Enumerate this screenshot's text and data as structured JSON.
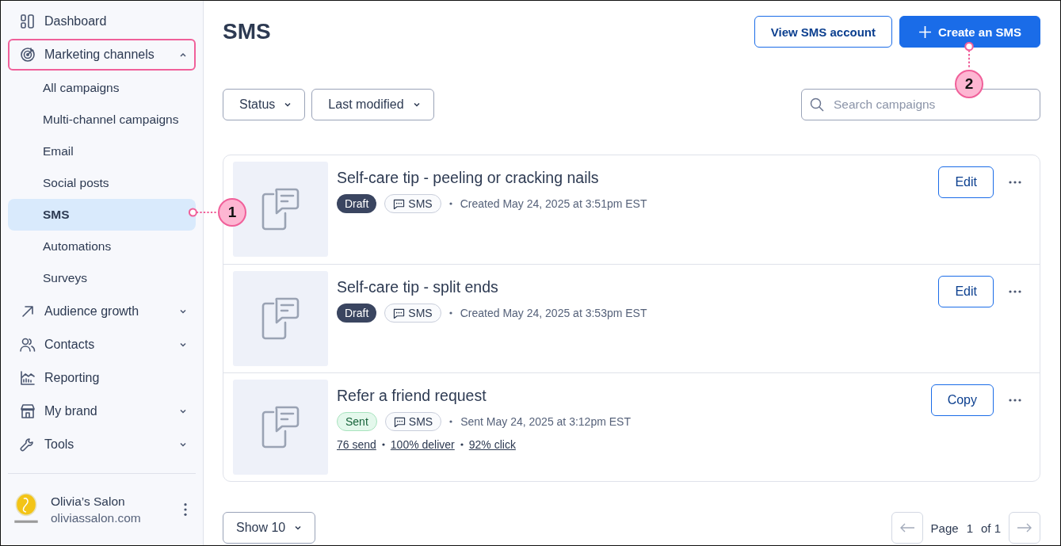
{
  "sidebar": {
    "items": [
      {
        "kind": "link",
        "label": "Dashboard"
      },
      {
        "kind": "group",
        "label": "Marketing channels",
        "expanded": true,
        "highlighted": true,
        "children": [
          {
            "label": "All campaigns",
            "selected": false
          },
          {
            "label": "Multi-channel campaigns",
            "selected": false
          },
          {
            "label": "Email",
            "selected": false
          },
          {
            "label": "Social posts",
            "selected": false
          },
          {
            "label": "SMS",
            "selected": true
          },
          {
            "label": "Automations",
            "selected": false
          },
          {
            "label": "Surveys",
            "selected": false
          }
        ]
      },
      {
        "kind": "group",
        "label": "Audience growth",
        "expanded": false,
        "highlighted": false
      },
      {
        "kind": "group",
        "label": "Contacts",
        "expanded": false,
        "highlighted": false
      },
      {
        "kind": "link",
        "label": "Reporting"
      },
      {
        "kind": "group",
        "label": "My brand",
        "expanded": false,
        "highlighted": false
      },
      {
        "kind": "group",
        "label": "Tools",
        "expanded": false,
        "highlighted": false
      }
    ],
    "account": {
      "name": "Olivia’s Salon",
      "domain": "oliviassalon.com"
    }
  },
  "page": {
    "title": "SMS",
    "buttons": [
      {
        "kind": "secondary",
        "label": "View SMS account"
      },
      {
        "kind": "primary",
        "label": "Create an SMS"
      }
    ]
  },
  "filters": [
    {
      "label": "Status"
    },
    {
      "label": "Last modified"
    }
  ],
  "search": {
    "placeholder": "Search campaigns"
  },
  "campaigns": [
    {
      "title": "Self-care tip - peeling or cracking nails",
      "status": {
        "kind": "draft",
        "label": "Draft"
      },
      "channel": "SMS",
      "meta": "Created May 24, 2025 at 3:51pm EST",
      "action": "Edit"
    },
    {
      "title": "Self-care tip - split ends",
      "status": {
        "kind": "draft",
        "label": "Draft"
      },
      "channel": "SMS",
      "meta": "Created May 24, 2025 at 3:53pm EST",
      "action": "Edit"
    },
    {
      "title": "Refer a friend request",
      "status": {
        "kind": "sent",
        "label": "Sent"
      },
      "channel": "SMS",
      "meta": "Sent May 24, 2025 at 3:12pm EST",
      "action": "Copy",
      "stats": [
        "76 send",
        "100% deliver",
        "92% click"
      ]
    }
  ],
  "footer": {
    "page_size": "Show 10",
    "page_label": "Page",
    "page": "1",
    "page_total": "of 1"
  },
  "callouts": [
    {
      "number": "1"
    },
    {
      "number": "2"
    }
  ]
}
